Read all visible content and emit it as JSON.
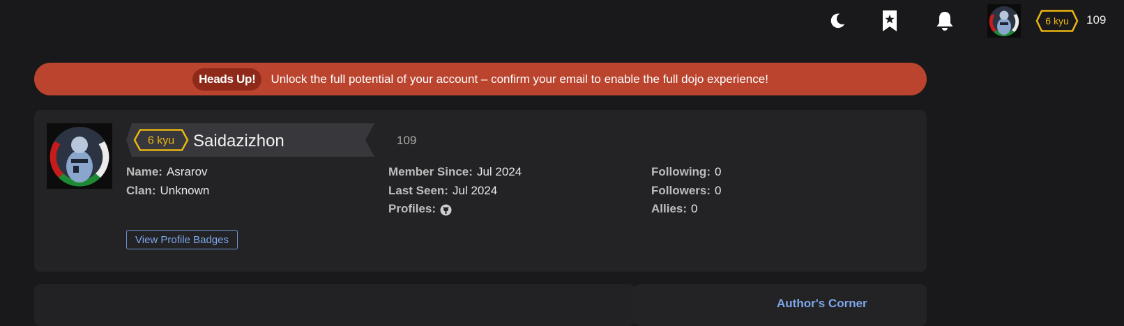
{
  "topbar": {
    "icons": [
      "moon-icon",
      "bookmark-star-icon",
      "bell-icon"
    ],
    "rank": "6 kyu",
    "honor": "109"
  },
  "banner": {
    "label": "Heads Up!",
    "message": "Unlock the full potential of your account – confirm your email to enable the full dojo experience!"
  },
  "profile": {
    "rank": "6 kyu",
    "username": "Saidazizhon",
    "honor": "109",
    "columns": [
      [
        {
          "label": "Name:",
          "value": "Asrarov"
        },
        {
          "label": "Clan:",
          "value": "Unknown"
        }
      ],
      [
        {
          "label": "Member Since:",
          "value": "Jul 2024"
        },
        {
          "label": "Last Seen:",
          "value": "Jul 2024"
        },
        {
          "label": "Profiles:",
          "value": ""
        }
      ],
      [
        {
          "label": "Following:",
          "value": "0"
        },
        {
          "label": "Followers:",
          "value": "0"
        },
        {
          "label": "Allies:",
          "value": "0"
        }
      ]
    ],
    "badges_button": "View Profile Badges"
  },
  "sidebar": {
    "authors_corner": "Author's Corner"
  },
  "colors": {
    "background": "#19191b",
    "card": "#232326",
    "banner": "#bb442e",
    "rank": "#ecb613",
    "link": "#7ea7ea"
  }
}
